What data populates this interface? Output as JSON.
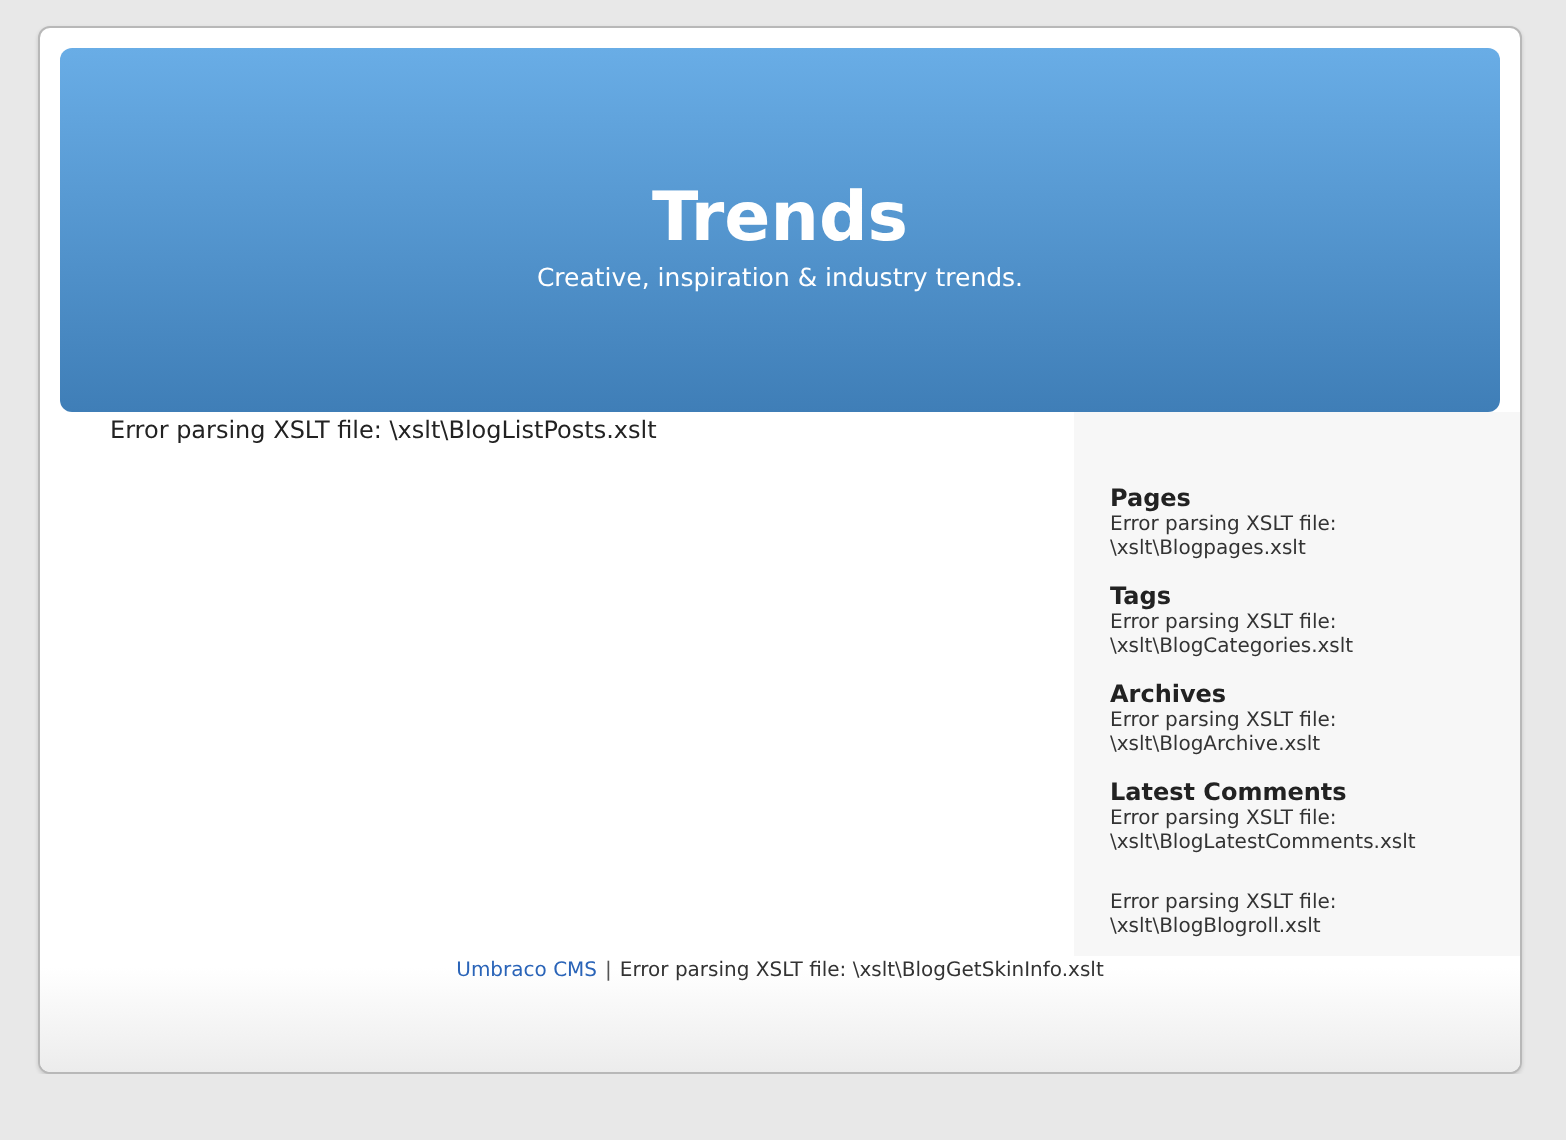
{
  "header": {
    "title": "Trends",
    "tagline": "Creative, inspiration & industry trends."
  },
  "main": {
    "message": "Error parsing XSLT file: \\xslt\\BlogListPosts.xslt"
  },
  "sidebar": {
    "sections": [
      {
        "heading": "Pages",
        "text": "Error parsing XSLT file: \\xslt\\Blogpages.xslt"
      },
      {
        "heading": "Tags",
        "text": "Error parsing XSLT file: \\xslt\\BlogCategories.xslt"
      },
      {
        "heading": "Archives",
        "text": "Error parsing XSLT file: \\xslt\\BlogArchive.xslt"
      },
      {
        "heading": "Latest Comments",
        "text": "Error parsing XSLT file: \\xslt\\BlogLatestComments.xslt"
      },
      {
        "text": "Error parsing XSLT file: \\xslt\\BlogBlogroll.xslt"
      }
    ]
  },
  "footer": {
    "link": "Umbraco CMS",
    "separator": "|",
    "message": "Error parsing XSLT file: \\xslt\\BlogGetSkinInfo.xslt"
  }
}
